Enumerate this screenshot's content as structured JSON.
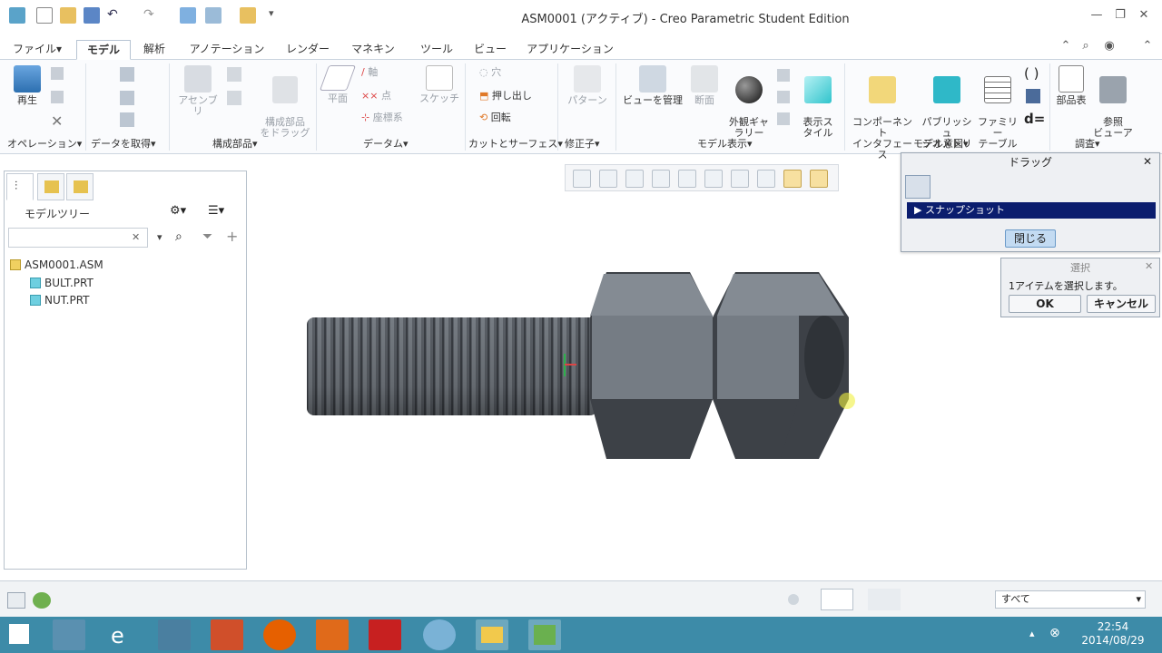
{
  "window": {
    "title": "ASM0001 (アクティブ) - Creo Parametric Student Edition"
  },
  "tabs": [
    "ファイル▾",
    "モデル",
    "解析",
    "アノテーション",
    "レンダー",
    "マネキン",
    "ツール",
    "ビュー",
    "アプリケーション"
  ],
  "ribbon": {
    "regen": "再生",
    "assemble": "アセンブリ",
    "drag_components": "構成部品\nをドラッグ",
    "plane": "平面",
    "axis": "軸",
    "point": "点",
    "csys": "座標系",
    "sketch": "スケッチ",
    "hole": "穴",
    "extrude": "押し出し",
    "revolve": "回転",
    "pattern": "パターン",
    "manage_views": "ビューを管理",
    "section": "断面",
    "appearance": "外観ギャ\nラリー",
    "display_style": "表示ス\nタイル",
    "component_interface": "コンポーネント\nインタフェース",
    "publish_geometry": "パブリッシュ\nジオメトリ",
    "family_table": "ファミリー\nテーブル",
    "d_equals": "d=",
    "bom": "部品表",
    "reference_viewer": "参照\nビューア",
    "groups": [
      "オペレーション▾",
      "データを取得▾",
      "構成部品▾",
      "データム▾",
      "カットとサーフェス▾",
      "修正子▾",
      "モデル表示▾",
      "モデル意図▾",
      "調査▾"
    ]
  },
  "left_panel": {
    "header": "モデルツリー",
    "search_value": "",
    "tree": [
      {
        "label": "ASM0001.ASM",
        "type": "asm"
      },
      {
        "label": "BULT.PRT",
        "type": "prt"
      },
      {
        "label": "NUT.PRT",
        "type": "prt"
      }
    ]
  },
  "drag_dialog": {
    "title": "ドラッグ",
    "item": "スナップショット",
    "close_btn": "閉じる"
  },
  "select_dialog": {
    "title": "選択",
    "message": "1アイテムを選択します。",
    "ok": "OK",
    "cancel": "キャンセル"
  },
  "statusbar": {
    "filter": "すべて"
  },
  "taskbar": {
    "time": "22:54",
    "date": "2014/08/29"
  },
  "colors": {
    "accent": "#0b1d6e",
    "ribbon_bg": "#fafbfd",
    "taskbar": "#3d8ba8",
    "model_dark": "#3d4147",
    "model_light": "#848b93"
  }
}
